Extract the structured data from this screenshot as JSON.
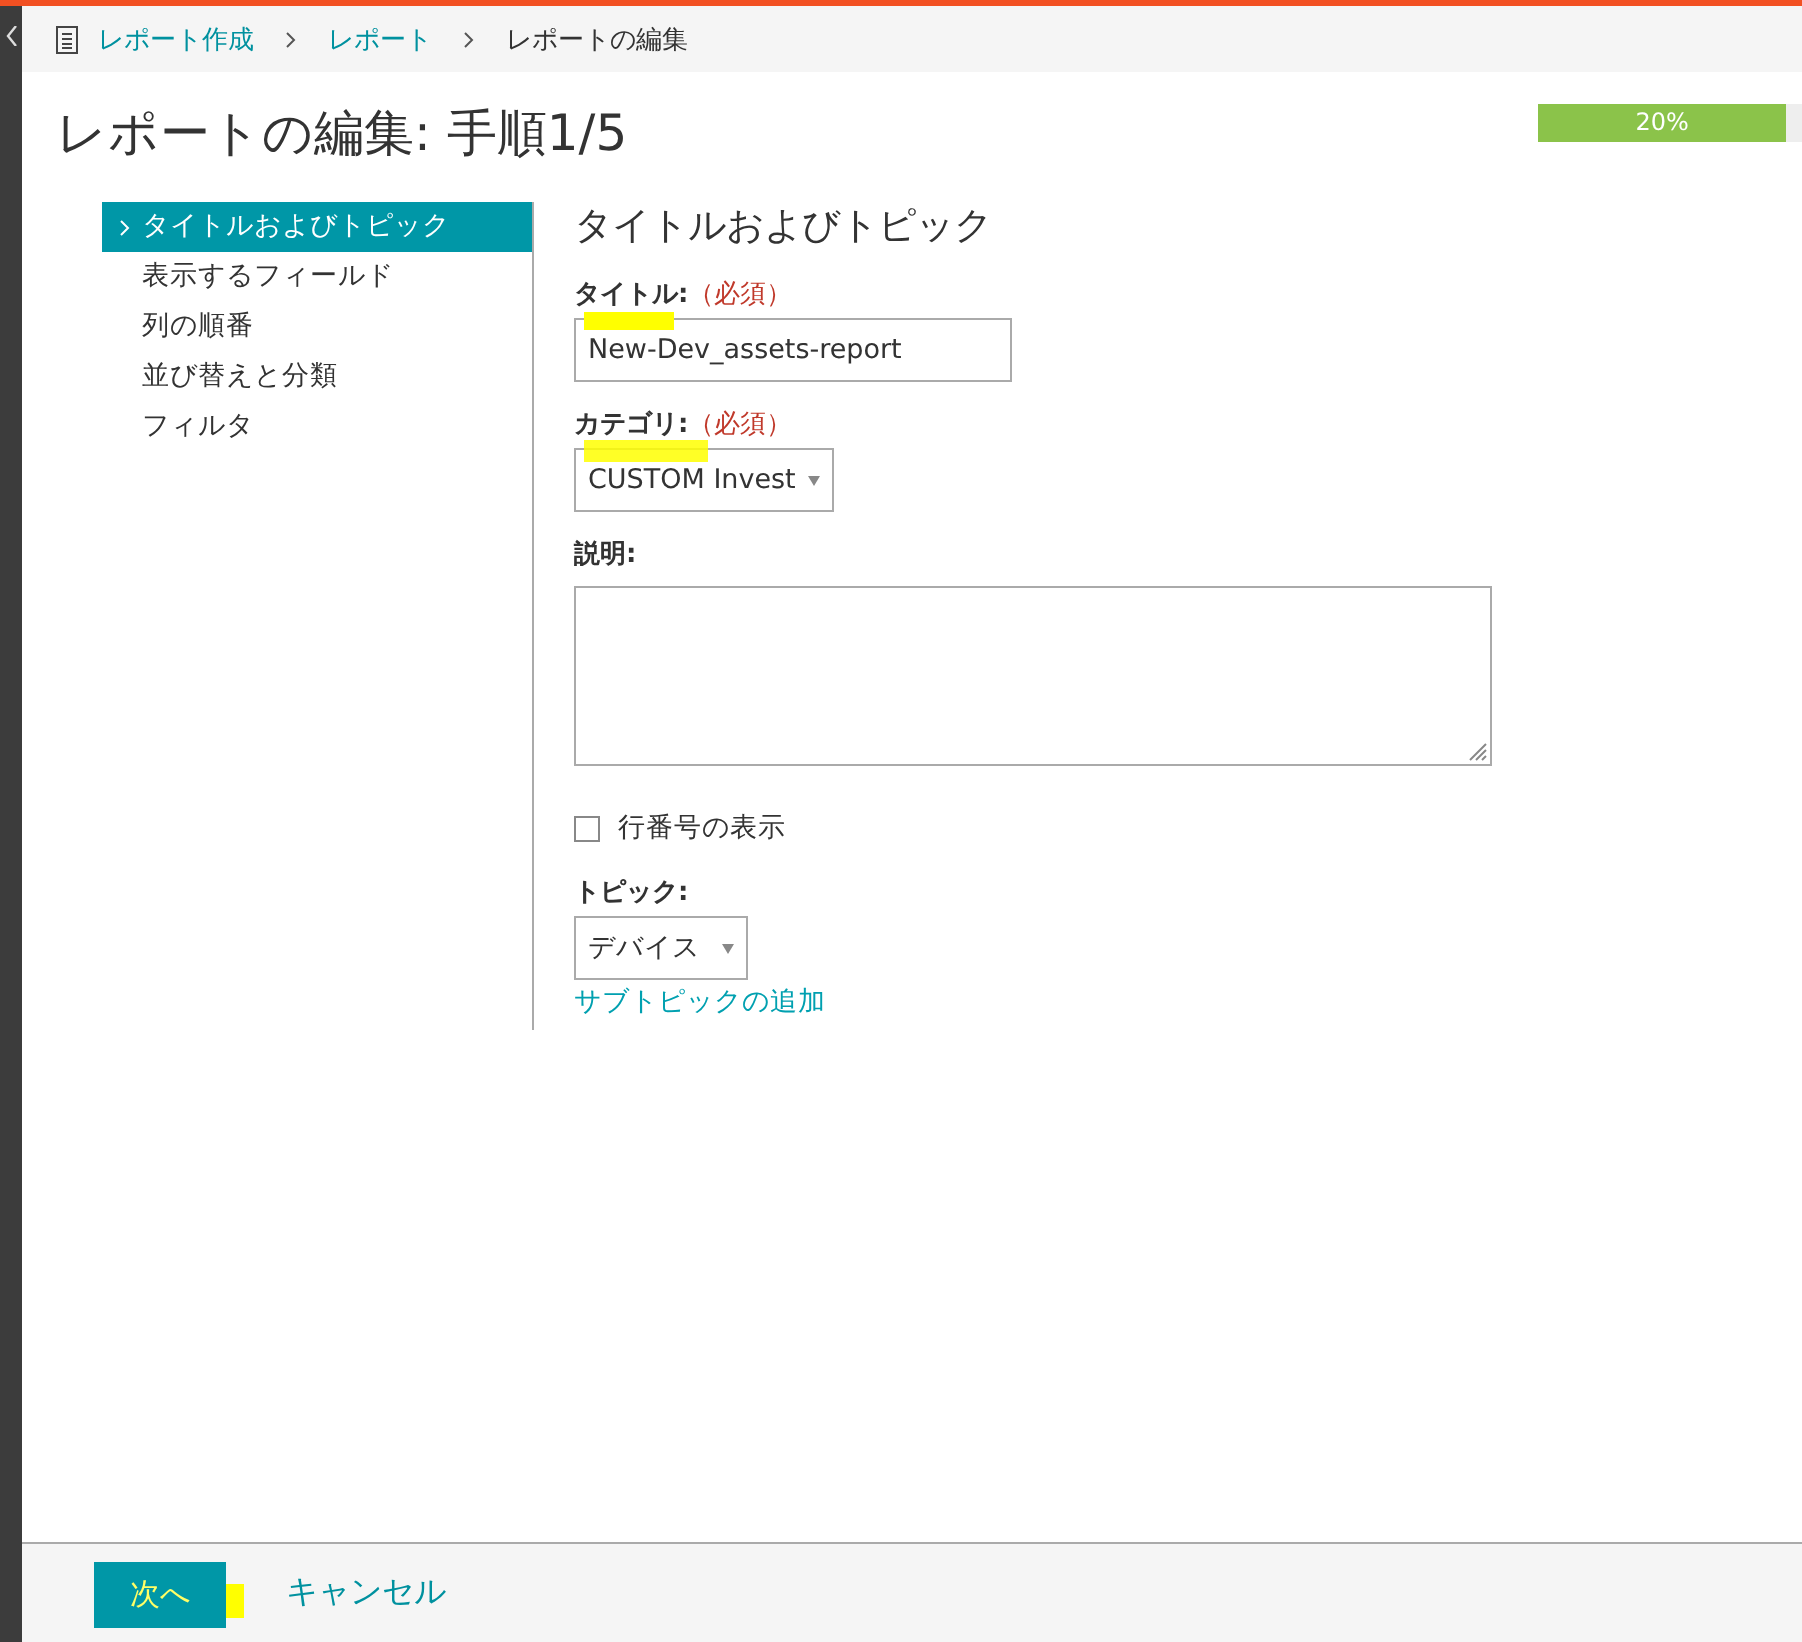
{
  "breadcrumb": [
    {
      "label": "レポート作成",
      "link": true
    },
    {
      "label": "レポート",
      "link": true
    },
    {
      "label": "レポートの編集",
      "link": false
    }
  ],
  "page_title": "レポートの編集: 手順1/5",
  "progress": {
    "level": 0.94,
    "reading": "20%"
  },
  "steps": [
    {
      "label": "タイトルおよびトピック",
      "selected": true
    },
    {
      "label": "表示するフィールド",
      "selected": false
    },
    {
      "label": "列の順番",
      "selected": false
    },
    {
      "label": "並び替えと分類",
      "selected": false
    },
    {
      "label": "フィルタ",
      "selected": false
    }
  ],
  "section_title": "タイトルおよびトピック",
  "title_field": {
    "label": "タイトル:",
    "required": "（必須）",
    "value": "New-Dev_assets-report",
    "highlighted": true
  },
  "category_field": {
    "label": "カテゴリ:",
    "required": "（必須）",
    "value": "CUSTOM Invest",
    "highlighted": true
  },
  "description_field": {
    "label": "説明:"
  },
  "row_numbers": {
    "label": "行番号の表示",
    "checked": false
  },
  "topic_field": {
    "label": "トピック:",
    "value": "デバイス"
  },
  "add_subtopic": "サブトピックの追加",
  "buttons": {
    "next": {
      "label": "次へ",
      "highlighted": true
    },
    "cancel": "キャンセル"
  }
}
